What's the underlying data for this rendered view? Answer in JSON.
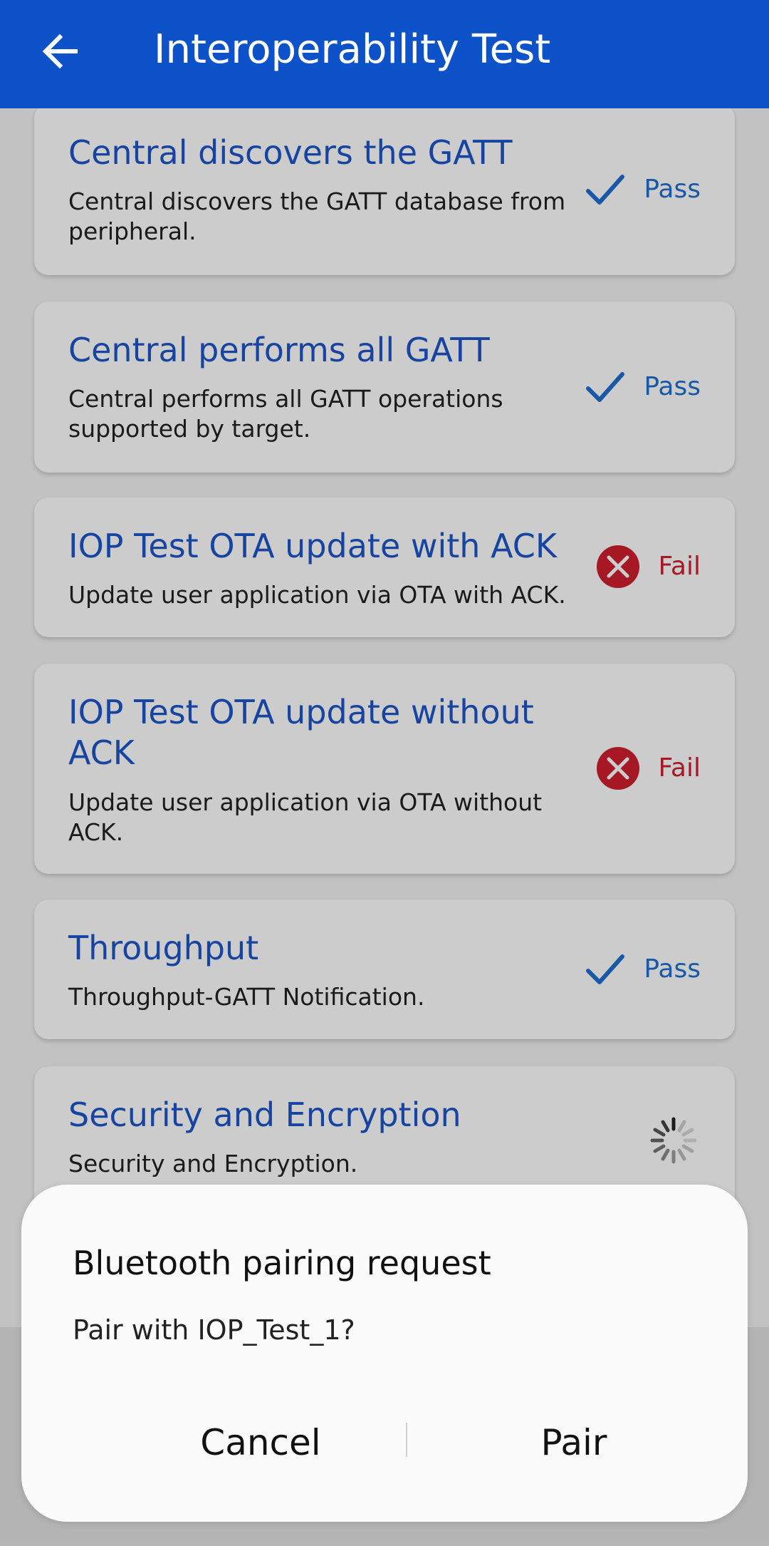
{
  "app_bar": {
    "title": "Interoperability Test",
    "back_icon": "arrow-back-icon",
    "color": "#0d52c8"
  },
  "tests": [
    {
      "title": "Central discovers the GATT",
      "description": "Central discovers the GATT database from peripheral.",
      "status": "pass",
      "status_label": "Pass",
      "status_icon": "check-icon"
    },
    {
      "title": "Central performs all GATT",
      "description": "Central performs all GATT operations supported by target.",
      "status": "pass",
      "status_label": "Pass",
      "status_icon": "check-icon"
    },
    {
      "title": "IOP Test OTA update with ACK",
      "description": "Update user application via OTA with ACK.",
      "status": "fail",
      "status_label": "Fail",
      "status_icon": "error-circle-icon"
    },
    {
      "title": "IOP Test OTA update without ACK",
      "description": "Update user application via OTA without ACK.",
      "status": "fail",
      "status_label": "Fail",
      "status_icon": "error-circle-icon"
    },
    {
      "title": "Throughput",
      "description": "Throughput-GATT Notification.",
      "status": "pass",
      "status_label": "Pass",
      "status_icon": "check-icon"
    },
    {
      "title": "Security and Encryption",
      "description": "Security and Encryption.",
      "status": "running",
      "status_icon": "spinner-icon"
    }
  ],
  "dialog": {
    "title": "Bluetooth pairing request",
    "message": "Pair with IOP_Test_1?",
    "cancel_label": "Cancel",
    "confirm_label": "Pair"
  },
  "colors": {
    "title_blue": "#1d56c9",
    "pass_blue": "#1f6fd0",
    "fail_red": "#cf1f2e"
  }
}
